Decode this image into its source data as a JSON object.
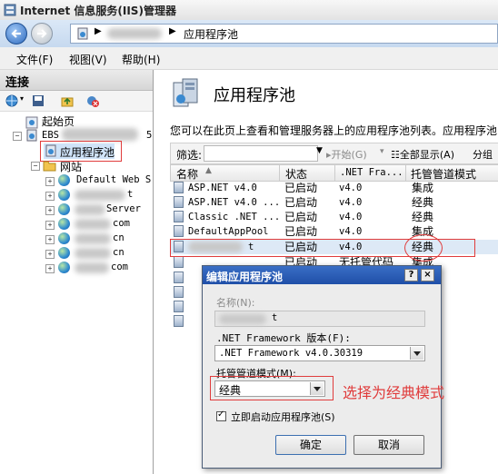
{
  "window": {
    "title": "Internet 信息服务(IIS)管理器"
  },
  "address": {
    "crumb_current": "应用程序池"
  },
  "menu": {
    "items": [
      "文件(F)",
      "视图(V)",
      "帮助(H)"
    ]
  },
  "connections": {
    "header": "连接",
    "start_page": "起始页",
    "server_prefix": "EBS",
    "server_suffix": "5",
    "app_pools": "应用程序池",
    "sites": "网站",
    "site_items": [
      "Default Web S",
      "t",
      "Server",
      "com",
      "cn",
      "cn",
      "com"
    ]
  },
  "main": {
    "title": "应用程序池",
    "description": "您可以在此页上查看和管理服务器上的应用程序池列表。应用程序池",
    "filter_label": "筛选:",
    "start_label": "开始(G)",
    "show_all_label": "全部显示(A)",
    "group_label": "分组",
    "columns": [
      "名称",
      "状态",
      ".NET Fra...",
      "托管管道模式"
    ],
    "rows": [
      {
        "name": "ASP.NET v4.0",
        "status": "已启动",
        "net": "v4.0",
        "mode": "集成"
      },
      {
        "name": "ASP.NET v4.0 ...",
        "status": "已启动",
        "net": "v4.0",
        "mode": "经典"
      },
      {
        "name": "Classic .NET ...",
        "status": "已启动",
        "net": "v4.0",
        "mode": "经典"
      },
      {
        "name": "DefaultAppPool",
        "status": "已启动",
        "net": "v4.0",
        "mode": "集成"
      },
      {
        "name": "t",
        "status": "已启动",
        "net": "v4.0",
        "mode": "经典"
      },
      {
        "name": "",
        "status": "已启动",
        "net": "无托管代码",
        "mode": "集成"
      }
    ]
  },
  "dialog": {
    "title": "编辑应用程序池",
    "help_btn": "?",
    "close_btn": "×",
    "name_label": "名称(N):",
    "name_value": "t",
    "net_label": ".NET Framework 版本(F):",
    "net_value": ".NET Framework v4.0.30319",
    "mode_label": "托管管道模式(M):",
    "mode_value": "经典",
    "start_checkbox": "立即启动应用程序池(S)",
    "ok": "确定",
    "cancel": "取消"
  },
  "annotation": {
    "text": "选择为经典模式",
    "color": "#e03c3c"
  }
}
